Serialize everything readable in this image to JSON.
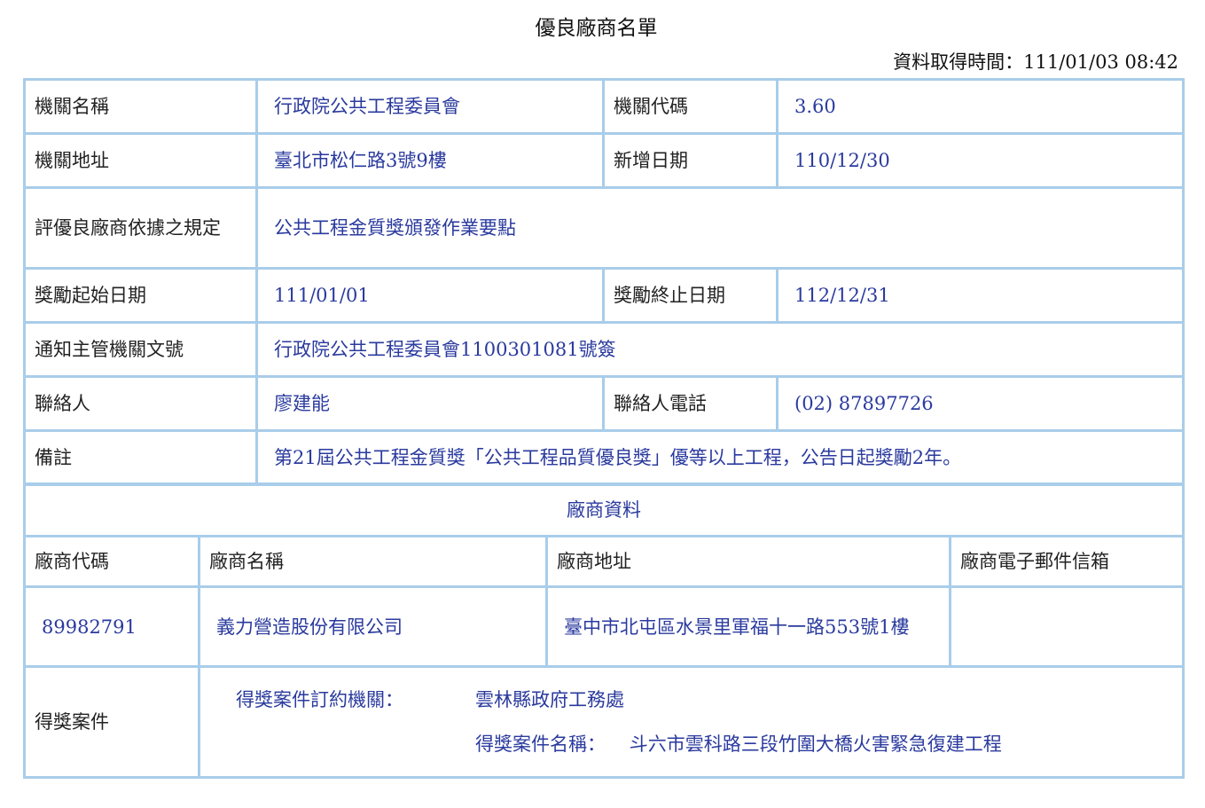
{
  "page": {
    "title": "優良廠商名單",
    "retrieved": "資料取得時間：111/01/03 08:42"
  },
  "agency": {
    "name_label": "機關名稱",
    "name": "行政院公共工程委員會",
    "code_label": "機關代碼",
    "code": "3.60",
    "address_label": "機關地址",
    "address": "臺北市松仁路3號9樓",
    "added_label": "新增日期",
    "added": "110/12/30",
    "rule_label": "評優良廠商依據之規定",
    "rule": "公共工程金質獎頒發作業要點",
    "start_label": "獎勵起始日期",
    "start": "111/01/01",
    "end_label": "獎勵終止日期",
    "end": "112/12/31",
    "doc_label": "通知主管機關文號",
    "doc": "行政院公共工程委員會1100301081號簽",
    "contact_label": "聯絡人",
    "contact": "廖建能",
    "phone_label": "聯絡人電話",
    "phone": "(02) 87897726",
    "note_label": "備註",
    "note": "第21屆公共工程金質獎「公共工程品質優良獎」優等以上工程，公告日起獎勵2年。"
  },
  "vendor": {
    "section": "廠商資料",
    "headers": [
      "廠商代碼",
      "廠商名稱",
      "廠商地址",
      "廠商電子郵件信箱"
    ],
    "code": "89982791",
    "name": "義力營造股份有限公司",
    "address": "臺中市北屯區水景里軍福十一路553號1樓",
    "email": "",
    "award_label": "得獎案件",
    "award_agency_label": "得獎案件訂約機關：",
    "award_agency": "雲林縣政府工務處",
    "award_name_label": "得獎案件名稱：",
    "award_name": "斗六市雲科路三段竹圍大橋火害緊急復建工程"
  }
}
